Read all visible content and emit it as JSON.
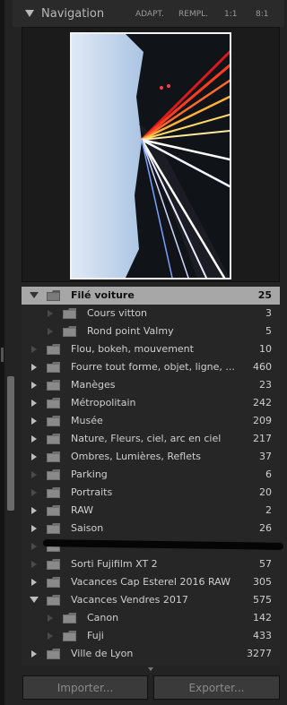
{
  "panel": {
    "title": "Navigation",
    "zoom_options": [
      "ADAPT.",
      "REMPL.",
      "1:1",
      "8:1"
    ]
  },
  "folders": [
    {
      "name": "Filé voiture",
      "count": "25",
      "selected": true,
      "state": "expanded",
      "level": 0
    },
    {
      "name": "Cours vitton",
      "count": "3",
      "state": "none",
      "level": 1
    },
    {
      "name": "Rond point Valmy",
      "count": "5",
      "state": "none",
      "level": 1
    },
    {
      "name": "Flou, bokeh, mouvement",
      "count": "10",
      "state": "none",
      "level": 0
    },
    {
      "name": "Fourre tout forme, objet, ligne, ...",
      "count": "460",
      "state": "collapsed",
      "level": 0
    },
    {
      "name": "Manèges",
      "count": "23",
      "state": "collapsed",
      "level": 0
    },
    {
      "name": "Métropolitain",
      "count": "242",
      "state": "collapsed",
      "level": 0
    },
    {
      "name": "Musée",
      "count": "209",
      "state": "collapsed",
      "level": 0
    },
    {
      "name": "Nature, Fleurs, ciel, arc en ciel",
      "count": "217",
      "state": "collapsed",
      "level": 0
    },
    {
      "name": "Ombres, Lumières, Reflets",
      "count": "37",
      "state": "collapsed",
      "level": 0
    },
    {
      "name": "Parking",
      "count": "6",
      "state": "none",
      "level": 0
    },
    {
      "name": "Portraits",
      "count": "20",
      "state": "none",
      "level": 0
    },
    {
      "name": "RAW",
      "count": "2",
      "state": "collapsed",
      "level": 0
    },
    {
      "name": "Saison",
      "count": "26",
      "state": "collapsed",
      "level": 0
    },
    {
      "name": "",
      "count": "",
      "state": "none",
      "level": 0,
      "redacted": true
    },
    {
      "name": "Sorti Fujifilm XT 2",
      "count": "57",
      "state": "none",
      "level": 0
    },
    {
      "name": "Vacances Cap Esterel 2016 RAW",
      "count": "305",
      "state": "collapsed",
      "level": 0
    },
    {
      "name": "Vacances Vendres 2017",
      "count": "575",
      "state": "expanded",
      "level": 0
    },
    {
      "name": "Canon",
      "count": "142",
      "state": "none",
      "level": 1
    },
    {
      "name": "Fuji",
      "count": "433",
      "state": "none",
      "level": 1
    },
    {
      "name": "Ville de Lyon",
      "count": "3277",
      "state": "collapsed",
      "level": 0
    }
  ],
  "buttons": {
    "import": "Importer...",
    "export": "Exporter..."
  },
  "colors": {
    "selected_row": "#a7a7a7",
    "panel_bg": "#262626"
  }
}
